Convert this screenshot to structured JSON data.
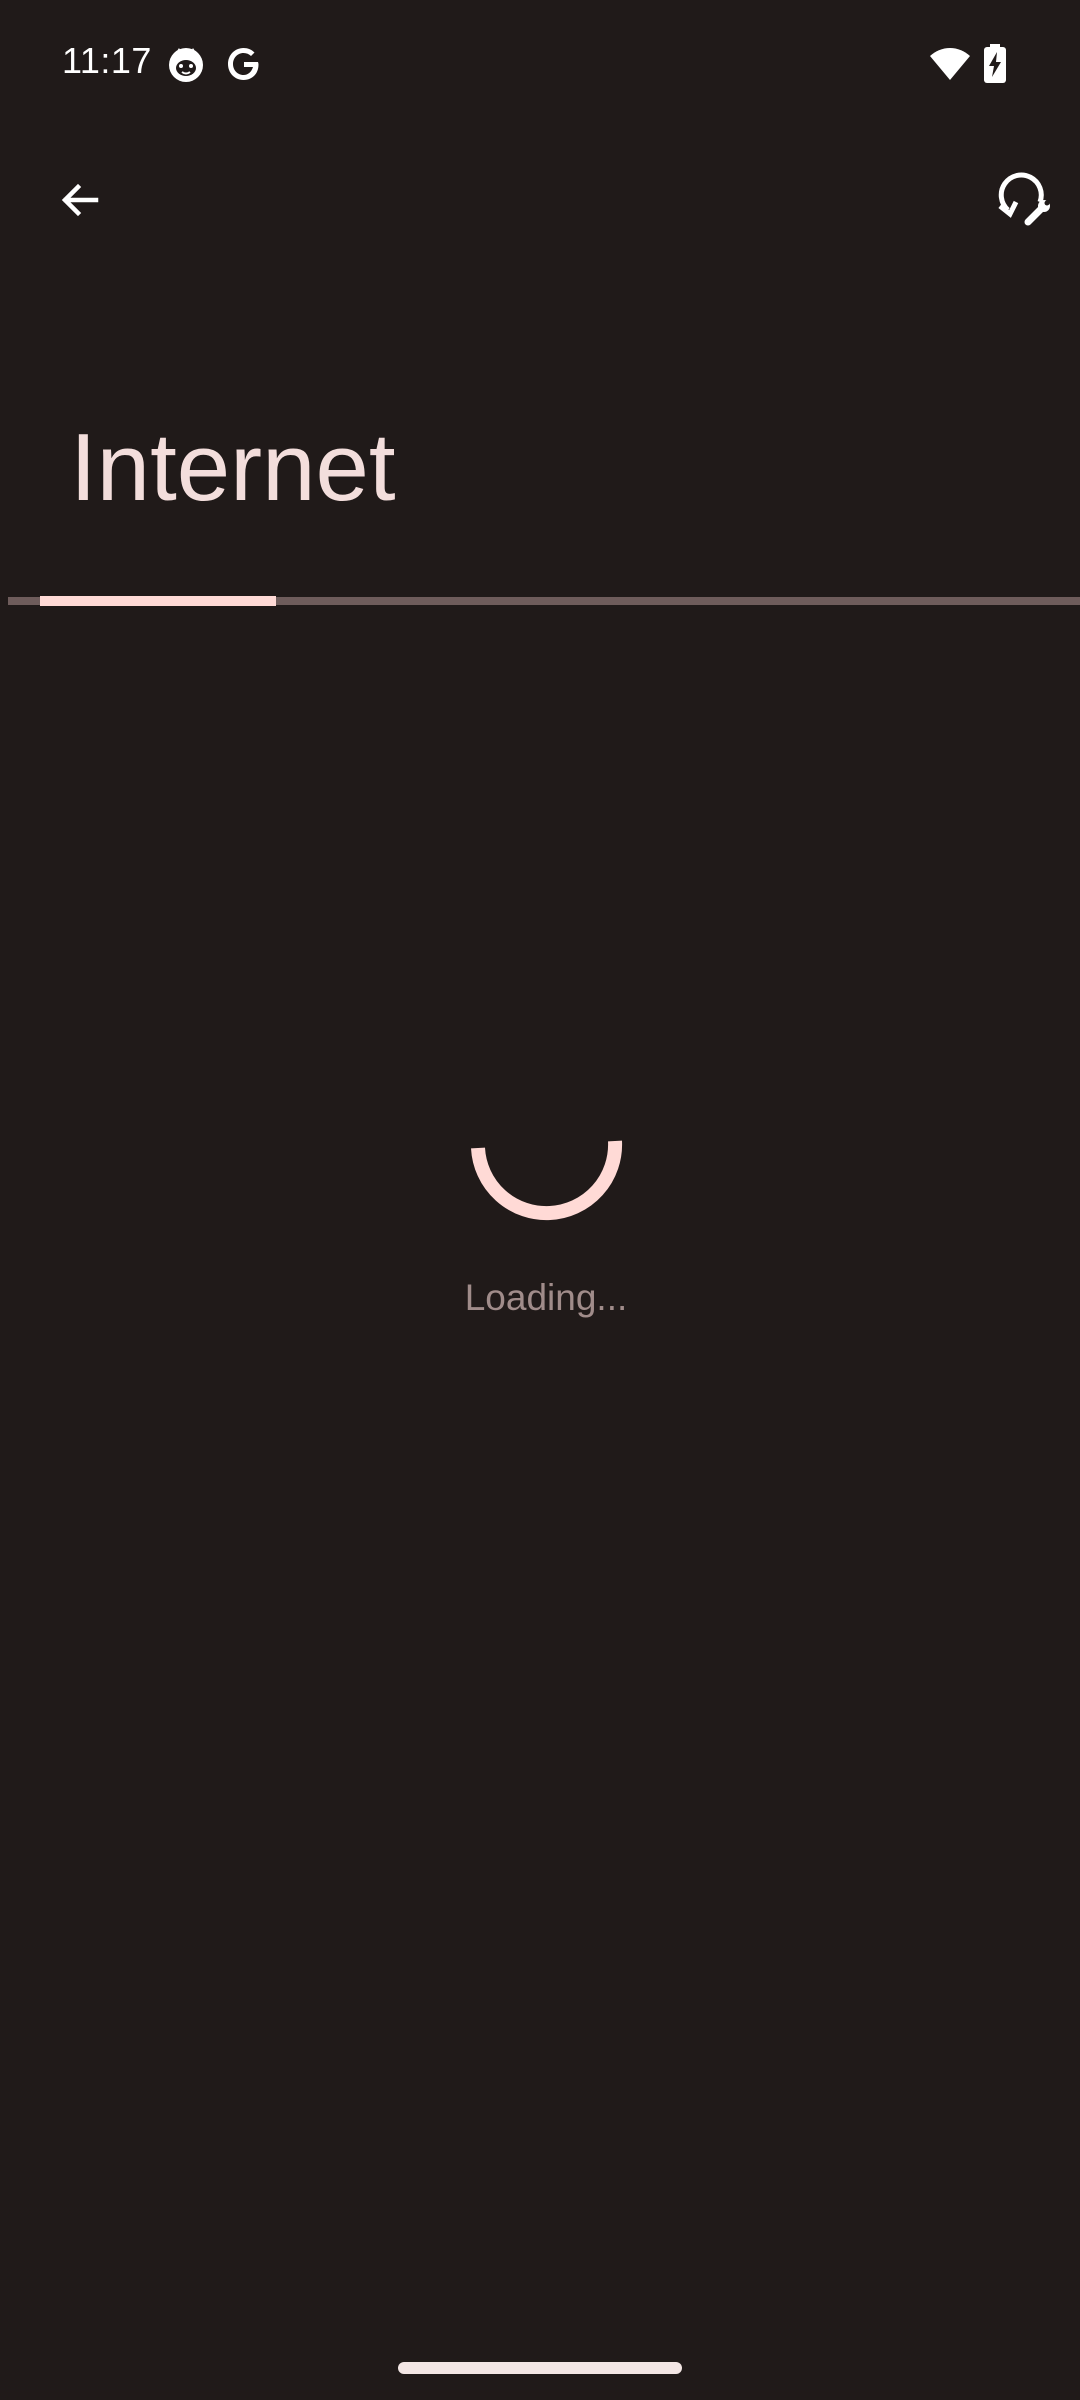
{
  "status_bar": {
    "time": "11:17",
    "icons": [
      "cat-face-icon",
      "google-g-icon",
      "wifi-icon",
      "battery-charging-icon"
    ]
  },
  "toolbar": {
    "back_icon": "arrow-left-icon",
    "action_icon": "network-reset-icon"
  },
  "page": {
    "title": "Internet"
  },
  "loading": {
    "text": "Loading...",
    "progress_fraction": 0.22
  },
  "colors": {
    "background": "#201a19",
    "accent": "#ffdad6",
    "track": "#6e5c5b",
    "muted_text": "#a08c8a"
  }
}
